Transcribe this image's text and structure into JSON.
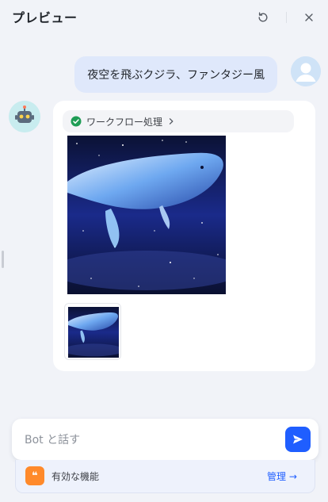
{
  "header": {
    "title": "プレビュー",
    "refresh_icon": "refresh-icon",
    "close_icon": "close-icon"
  },
  "conversation": {
    "user_message": "夜空を飛ぶクジラ、ファンタジー風",
    "bot": {
      "workflow_status": "ワークフロー処理",
      "workflow_status_color": "#1f9d55",
      "generated_image": "whale-in-night-sky-image"
    }
  },
  "composer": {
    "placeholder": "Bot と話す",
    "send_icon": "send-icon",
    "accent": "#1f5eff"
  },
  "features_bar": {
    "label": "有効な機能",
    "manage_label": "管理",
    "manage_arrow": "→",
    "icon": "quote-icon",
    "icon_color": "#ff8a2b"
  }
}
